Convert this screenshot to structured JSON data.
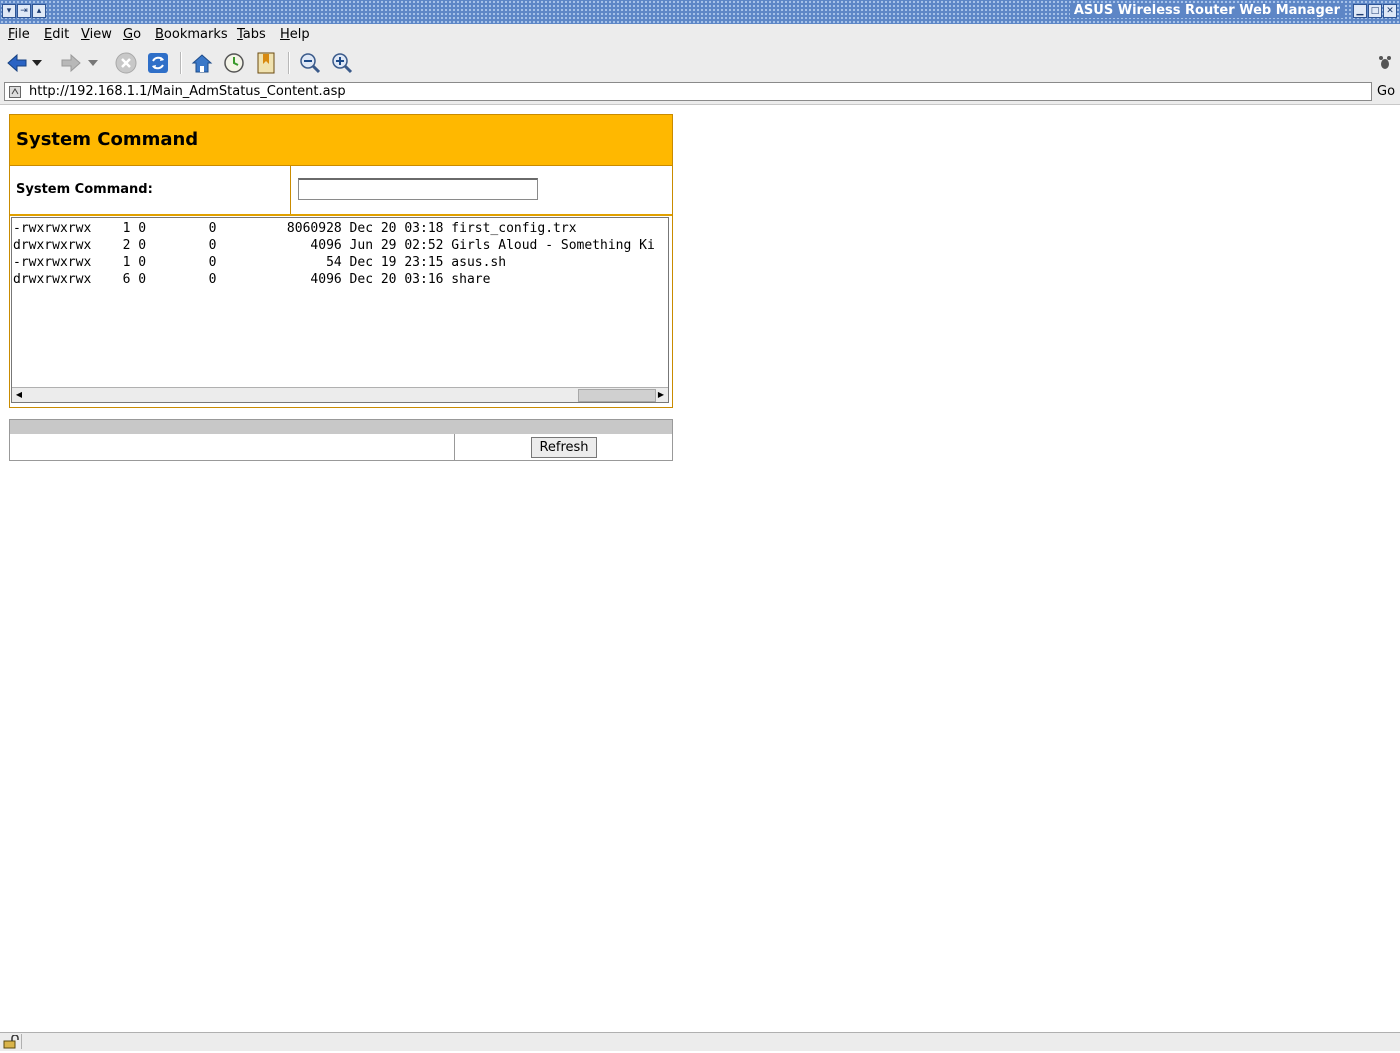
{
  "window": {
    "title": "ASUS Wireless Router Web Manager"
  },
  "menu": {
    "items": [
      {
        "label": "File"
      },
      {
        "label": "Edit"
      },
      {
        "label": "View"
      },
      {
        "label": "Go"
      },
      {
        "label": "Bookmarks"
      },
      {
        "label": "Tabs"
      },
      {
        "label": "Help"
      }
    ]
  },
  "toolbar": {
    "icons": [
      "back-icon",
      "back-dropdown-icon",
      "forward-icon",
      "forward-dropdown-icon",
      "stop-icon",
      "reload-icon",
      "home-icon",
      "history-icon",
      "bookmarks-icon",
      "zoom-out-icon",
      "zoom-in-icon"
    ]
  },
  "address": {
    "url": "http://192.168.1.1/Main_AdmStatus_Content.asp",
    "go_label": "Go"
  },
  "page": {
    "title": "System Command",
    "command_label": "System Command:",
    "command_value": "",
    "output_lines": [
      "-rwxrwxrwx    1 0        0         8060928 Dec 20 03:18 first_config.trx",
      "drwxrwxrwx    2 0        0            4096 Jun 29 02:52 Girls Aloud - Something Ki",
      "-rwxrwxrwx    1 0        0              54 Dec 19 23:15 asus.sh",
      "drwxrwxrwx    6 0        0            4096 Dec 20 03:16 share"
    ],
    "refresh_label": "Refresh"
  },
  "colors": {
    "header_bg": "#ffb800",
    "titlebar_bg": "#5d86c6"
  }
}
